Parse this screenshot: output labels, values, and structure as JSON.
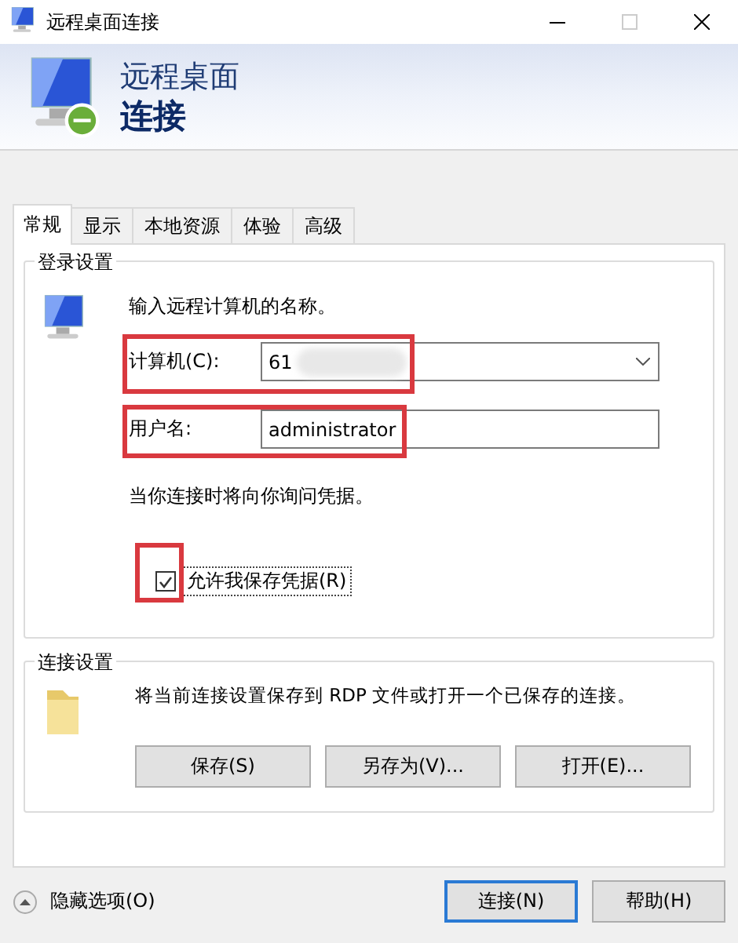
{
  "window": {
    "title": "远程桌面连接"
  },
  "header": {
    "line1": "远程桌面",
    "line2": "连接"
  },
  "tabs": [
    {
      "label": "常规",
      "selected": true
    },
    {
      "label": "显示",
      "selected": false
    },
    {
      "label": "本地资源",
      "selected": false
    },
    {
      "label": "体验",
      "selected": false
    },
    {
      "label": "高级",
      "selected": false
    }
  ],
  "login_group": {
    "title": "登录设置",
    "prompt": "输入远程计算机的名称。",
    "computer": {
      "label": "计算机(C):",
      "value": "61"
    },
    "username": {
      "label": "用户名:",
      "value": "administrator"
    },
    "note": "当你连接时将向你询问凭据。",
    "save_credentials": {
      "label": "允许我保存凭据(R)",
      "checked": true
    }
  },
  "connection_group": {
    "title": "连接设置",
    "description": "将当前连接设置保存到 RDP 文件或打开一个已保存的连接。",
    "buttons": [
      "保存(S)",
      "另存为(V)...",
      "打开(E)..."
    ]
  },
  "footer": {
    "hide_options": "隐藏选项(O)",
    "buttons": [
      {
        "label": "连接(N)",
        "default": true
      },
      {
        "label": "帮助(H)",
        "default": false
      }
    ]
  }
}
